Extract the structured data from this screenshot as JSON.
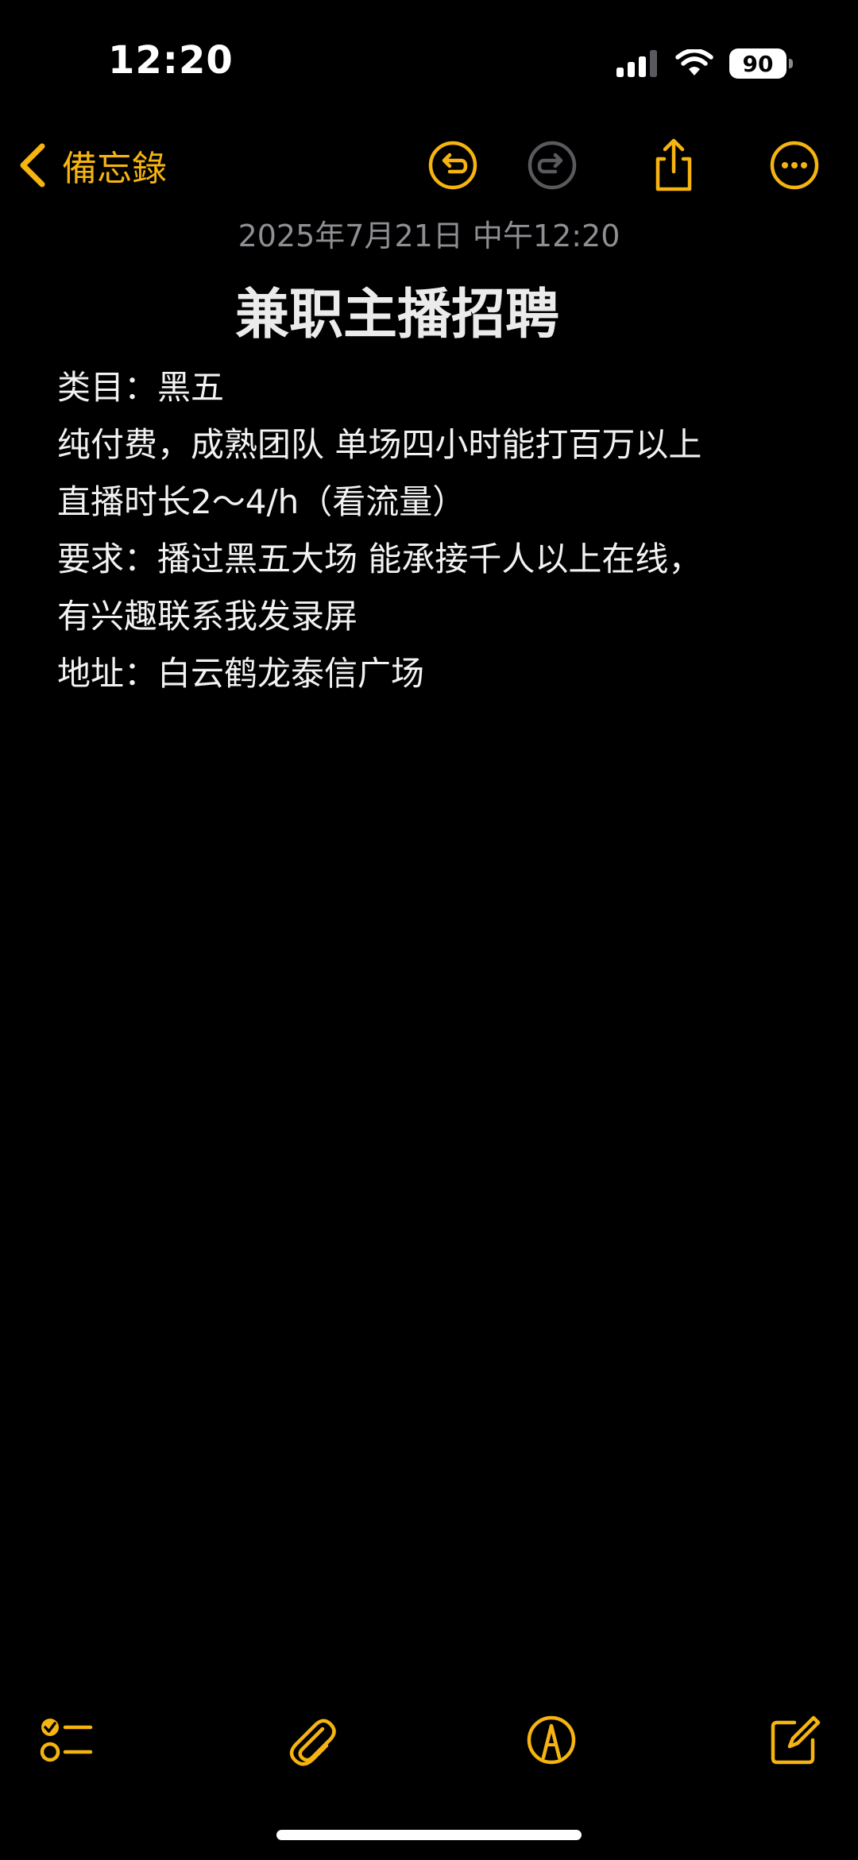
{
  "status_bar": {
    "time": "12:20",
    "battery": "90"
  },
  "nav": {
    "back_label": "備忘錄",
    "icons": [
      "chevron-left-icon",
      "undo-icon",
      "redo-icon",
      "share-icon",
      "more-icon"
    ]
  },
  "note": {
    "date": "2025年7月21日 中午12:20",
    "title": "兼职主播招聘",
    "lines": [
      "类目：黑五",
      "纯付费，成熟团队 单场四小时能打百万以上",
      "直播时长2～4/h（看流量）",
      "要求：播过黑五大场 能承接千人以上在线，",
      "有兴趣联系我发录屏",
      "地址：白云鹤龙泰信广场"
    ]
  },
  "toolbar": {
    "icons": [
      "checklist-icon",
      "attachment-icon",
      "markup-icon",
      "compose-icon"
    ]
  },
  "colors": {
    "accent": "#f5b40f",
    "background": "#000000",
    "secondary_text": "#8e8e93",
    "disabled_icon": "#5a5a5e"
  }
}
